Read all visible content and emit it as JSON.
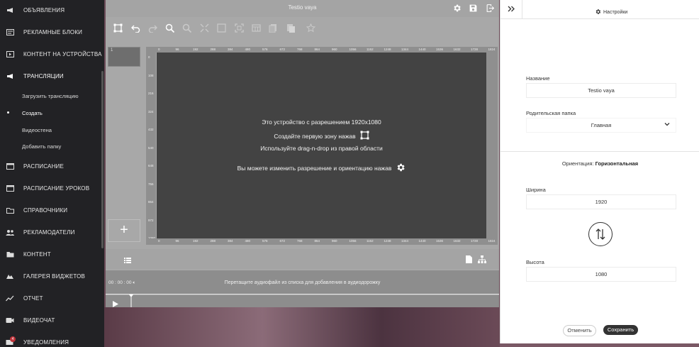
{
  "sidebar": {
    "items": [
      {
        "label": "ОБЪЯВЛЕНИЯ",
        "icon": "announcement-icon"
      },
      {
        "label": "РЕКЛАМНЫЕ БЛОКИ",
        "icon": "blocks-icon"
      },
      {
        "label": "КОНТЕНТ НА УСТРОЙСТВА",
        "icon": "device-content-icon"
      },
      {
        "label": "ТРАНСЛЯЦИИ",
        "icon": "broadcast-icon"
      },
      {
        "label": "РАСПИСАНИЕ",
        "icon": "calendar-icon"
      },
      {
        "label": "РАСПИСАНИЕ УРОКОВ",
        "icon": "lessons-calendar-icon"
      },
      {
        "label": "СПРАВОЧНИКИ",
        "icon": "folder-icon"
      },
      {
        "label": "РЕКЛАМОДАТЕЛИ",
        "icon": "people-icon"
      },
      {
        "label": "КОНТЕНТ",
        "icon": "content-folder-icon"
      },
      {
        "label": "ГАЛЕРЕЯ ВИДЖЕТОВ",
        "icon": "widgets-icon"
      },
      {
        "label": "ОТЧЕТ",
        "icon": "chart-icon"
      },
      {
        "label": "ВИДЕОЧАТ",
        "icon": "videochat-icon"
      },
      {
        "label": "УВЕДОМЛЕНИЯ",
        "icon": "notifications-icon"
      }
    ],
    "subitems": [
      {
        "label": "Загрузить трансляцию"
      },
      {
        "label": "Создать",
        "active": true
      },
      {
        "label": "Видеостена"
      },
      {
        "label": "Добавить папку"
      }
    ],
    "notif_badge": "4"
  },
  "editor": {
    "title": "Testio vaya",
    "thumb_number": "1",
    "add_symbol": "+",
    "messages": {
      "line1": "Это устройство с разрешением 1920x1080",
      "line2": "Создайте первую зону нажав",
      "line3": "Используйте drag-n-drop из правой области",
      "line4": "Вы можете изменить разрешение и ориентацию нажав"
    },
    "ruler_top": [
      "0",
      "96",
      "192",
      "288",
      "384",
      "480",
      "576",
      "672",
      "768",
      "864",
      "960",
      "1056",
      "1152",
      "1248",
      "1344",
      "1440",
      "1536",
      "1632",
      "1728",
      "1824"
    ],
    "ruler_left": [
      "0",
      "108",
      "216",
      "324",
      "432",
      "540",
      "648",
      "756",
      "864",
      "972",
      "1080"
    ],
    "audio_time": "00 : 00 : 00",
    "audio_hint": "Перетащите аудиофайл из списка для добавления в аудиодорожку"
  },
  "panel": {
    "settings_label": "Настройки",
    "name_label": "Название",
    "name_value": "Testio vaya",
    "parent_label": "Родительская папка",
    "parent_value": "Главная",
    "orientation_prefix": "Ориентация:",
    "orientation_value": "Горизонтальная",
    "width_label": "Ширина",
    "width_value": "1920",
    "height_label": "Высота",
    "height_value": "1080",
    "cancel_label": "Отменить",
    "save_label": "Сохранить"
  }
}
